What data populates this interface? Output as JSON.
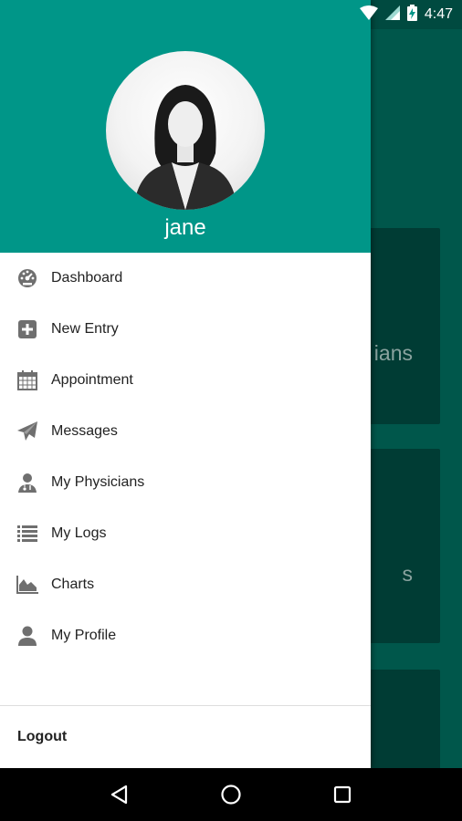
{
  "status_bar": {
    "time": "4:47",
    "icons": [
      "wifi-icon",
      "signal-icon",
      "battery-charging-icon"
    ]
  },
  "background": {
    "cards": [
      {
        "partial_text": "ians"
      },
      {
        "partial_text": "s"
      },
      {
        "partial_text": ""
      }
    ]
  },
  "drawer": {
    "header": {
      "username": "jane",
      "bg_color": "#009688"
    },
    "items": [
      {
        "label": "Dashboard",
        "icon": "dashboard-icon"
      },
      {
        "label": "New Entry",
        "icon": "plus-box-icon"
      },
      {
        "label": "Appointment",
        "icon": "calendar-icon"
      },
      {
        "label": "Messages",
        "icon": "send-icon"
      },
      {
        "label": "My Physicians",
        "icon": "doctor-icon"
      },
      {
        "label": "My Logs",
        "icon": "list-icon"
      },
      {
        "label": "Charts",
        "icon": "area-chart-icon"
      },
      {
        "label": "My Profile",
        "icon": "user-icon"
      }
    ],
    "logout_label": "Logout"
  },
  "nav_bar": {
    "buttons": [
      "back-icon",
      "home-icon",
      "recents-icon"
    ]
  }
}
